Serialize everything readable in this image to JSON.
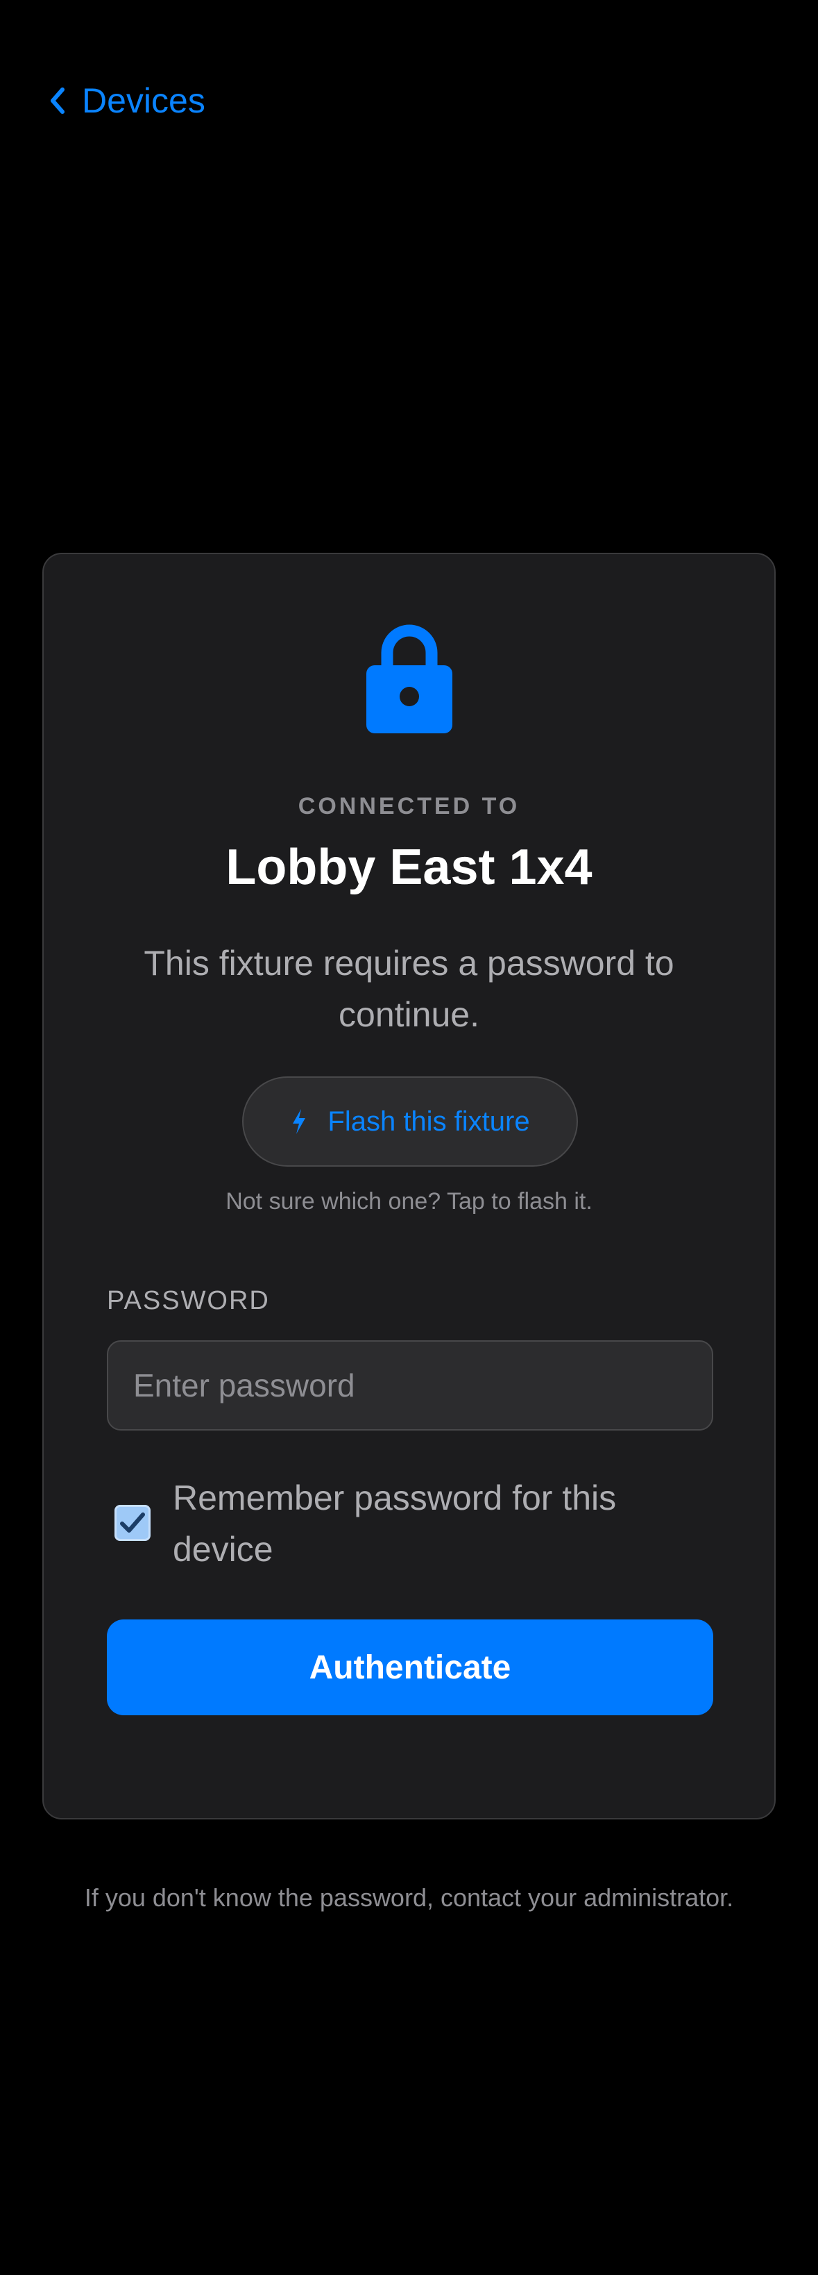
{
  "nav": {
    "back_label": "Devices",
    "back_icon": "chevron-left-icon"
  },
  "card": {
    "icon": "lock-icon",
    "eyebrow": "CONNECTED TO",
    "device_name": "Lobby East 1x4",
    "message": "This fixture requires a password to continue.",
    "flash_button": {
      "icon": "lightning-bolt-icon",
      "label": "Flash this fixture"
    },
    "flash_hint": "Not sure which one? Tap to flash it.",
    "password": {
      "label": "PASSWORD",
      "placeholder": "Enter password",
      "value": ""
    },
    "remember": {
      "label": "Remember password for this device",
      "checked": true
    },
    "submit_label": "Authenticate"
  },
  "footer": {
    "note": "If you don't know the password, contact your administrator."
  },
  "colors": {
    "accent": "#007aff",
    "accent_text": "#0a84ff",
    "card_background": "#1c1c1e",
    "page_background": "#000000",
    "secondary_text": "#8e8e93"
  }
}
